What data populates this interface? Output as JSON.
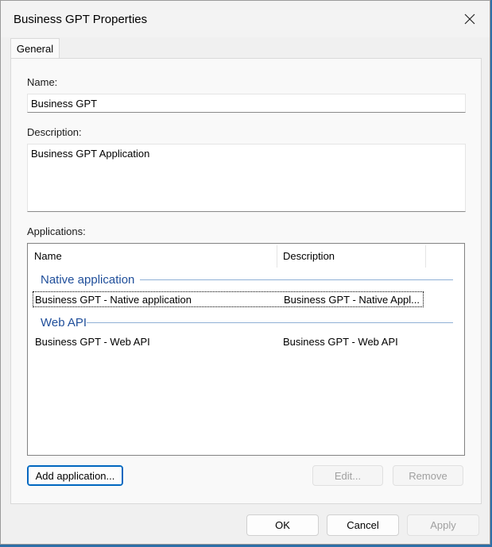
{
  "window": {
    "title": "Business GPT Properties"
  },
  "tabs": [
    {
      "label": "General"
    }
  ],
  "form": {
    "name_label": "Name:",
    "name_value": "Business GPT",
    "description_label": "Description:",
    "description_value": "Business GPT Application",
    "applications_label": "Applications:"
  },
  "applications": {
    "columns": [
      "Name",
      "Description"
    ],
    "groups": [
      {
        "title": "Native application",
        "rows": [
          {
            "name": "Business GPT - Native application",
            "description": "Business GPT - Native Appl..."
          }
        ]
      },
      {
        "title": "Web API",
        "rows": [
          {
            "name": "Business GPT - Web API",
            "description": "Business GPT - Web API"
          }
        ]
      }
    ]
  },
  "buttons": {
    "add": "Add application...",
    "edit": "Edit...",
    "remove": "Remove",
    "ok": "OK",
    "cancel": "Cancel",
    "apply": "Apply"
  }
}
